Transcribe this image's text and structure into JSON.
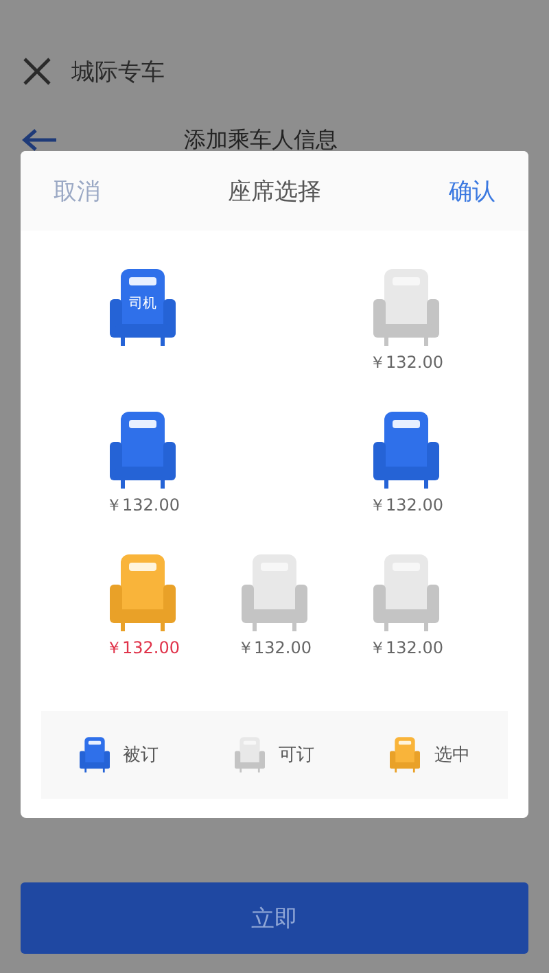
{
  "page": {
    "title": "城际专车",
    "subtitle": "添加乘车人信息",
    "submit_button": "立即"
  },
  "dialog": {
    "cancel": "取消",
    "title": "座席选择",
    "confirm": "确认"
  },
  "seat_rows": [
    [
      {
        "kind": "booked",
        "label": "司机"
      },
      {
        "kind": "empty"
      },
      {
        "kind": "available",
        "price": "￥132.00"
      }
    ],
    [
      {
        "kind": "booked",
        "price": "￥132.00"
      },
      {
        "kind": "empty"
      },
      {
        "kind": "booked",
        "price": "￥132.00"
      }
    ],
    [
      {
        "kind": "selected",
        "price": "￥132.00"
      },
      {
        "kind": "available",
        "price": "￥132.00"
      },
      {
        "kind": "available",
        "price": "￥132.00"
      }
    ]
  ],
  "legend": [
    {
      "kind": "booked",
      "label": "被订"
    },
    {
      "kind": "available",
      "label": "可订"
    },
    {
      "kind": "selected",
      "label": "选中"
    }
  ]
}
